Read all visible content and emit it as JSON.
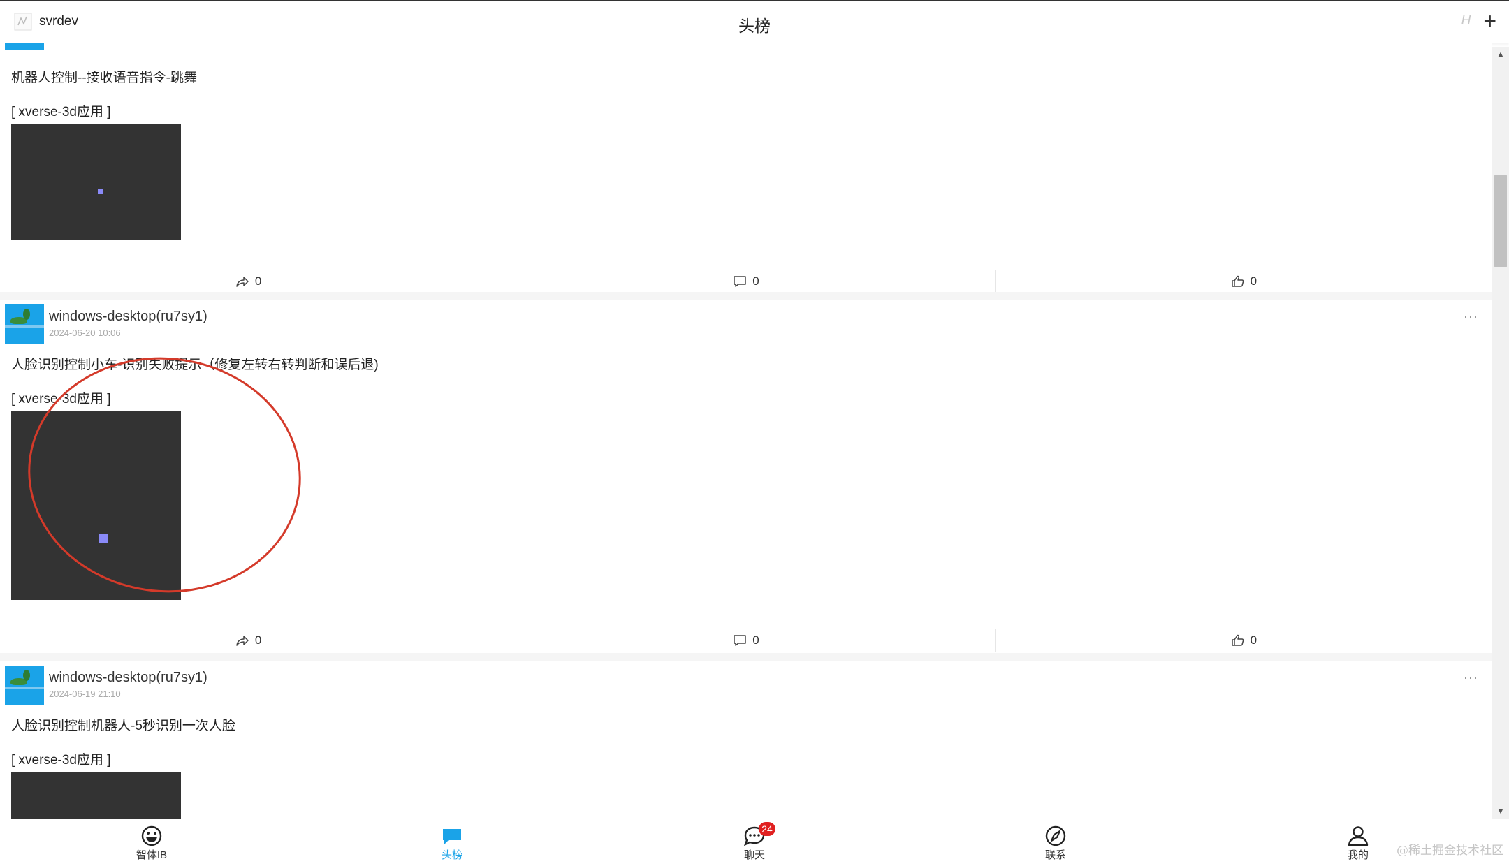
{
  "header": {
    "username": "svrdev",
    "title": "头榜",
    "hint": "H",
    "add": "+"
  },
  "posts": [
    {
      "title": "机器人控制--接收语音指令-跳舞",
      "tag": "[ xverse-3d应用 ]",
      "shares": "0",
      "comments": "0",
      "likes": "0"
    },
    {
      "author": "windows-desktop(ru7sy1)",
      "time": "2024-06-20 10:06",
      "more": "···",
      "title": "人脸识别控制小车-识别失败提示（修复左转右转判断和误后退)",
      "tag": "[ xverse-3d应用 ]",
      "shares": "0",
      "comments": "0",
      "likes": "0"
    },
    {
      "author": "windows-desktop(ru7sy1)",
      "time": "2024-06-19 21:10",
      "more": "···",
      "title": "人脸识别控制机器人-5秒识别一次人脸",
      "tag": "[ xverse-3d应用 ]"
    }
  ],
  "nav": {
    "items": [
      "智体IB",
      "头榜",
      "聊天",
      "联系",
      "我的"
    ],
    "chat_badge": "24"
  },
  "watermark": "@稀土掘金技术社区",
  "colors": {
    "accent": "#1aa3e8",
    "badge": "#e02020",
    "annotation": "#d43a2a",
    "thumb_bg": "#333333"
  }
}
